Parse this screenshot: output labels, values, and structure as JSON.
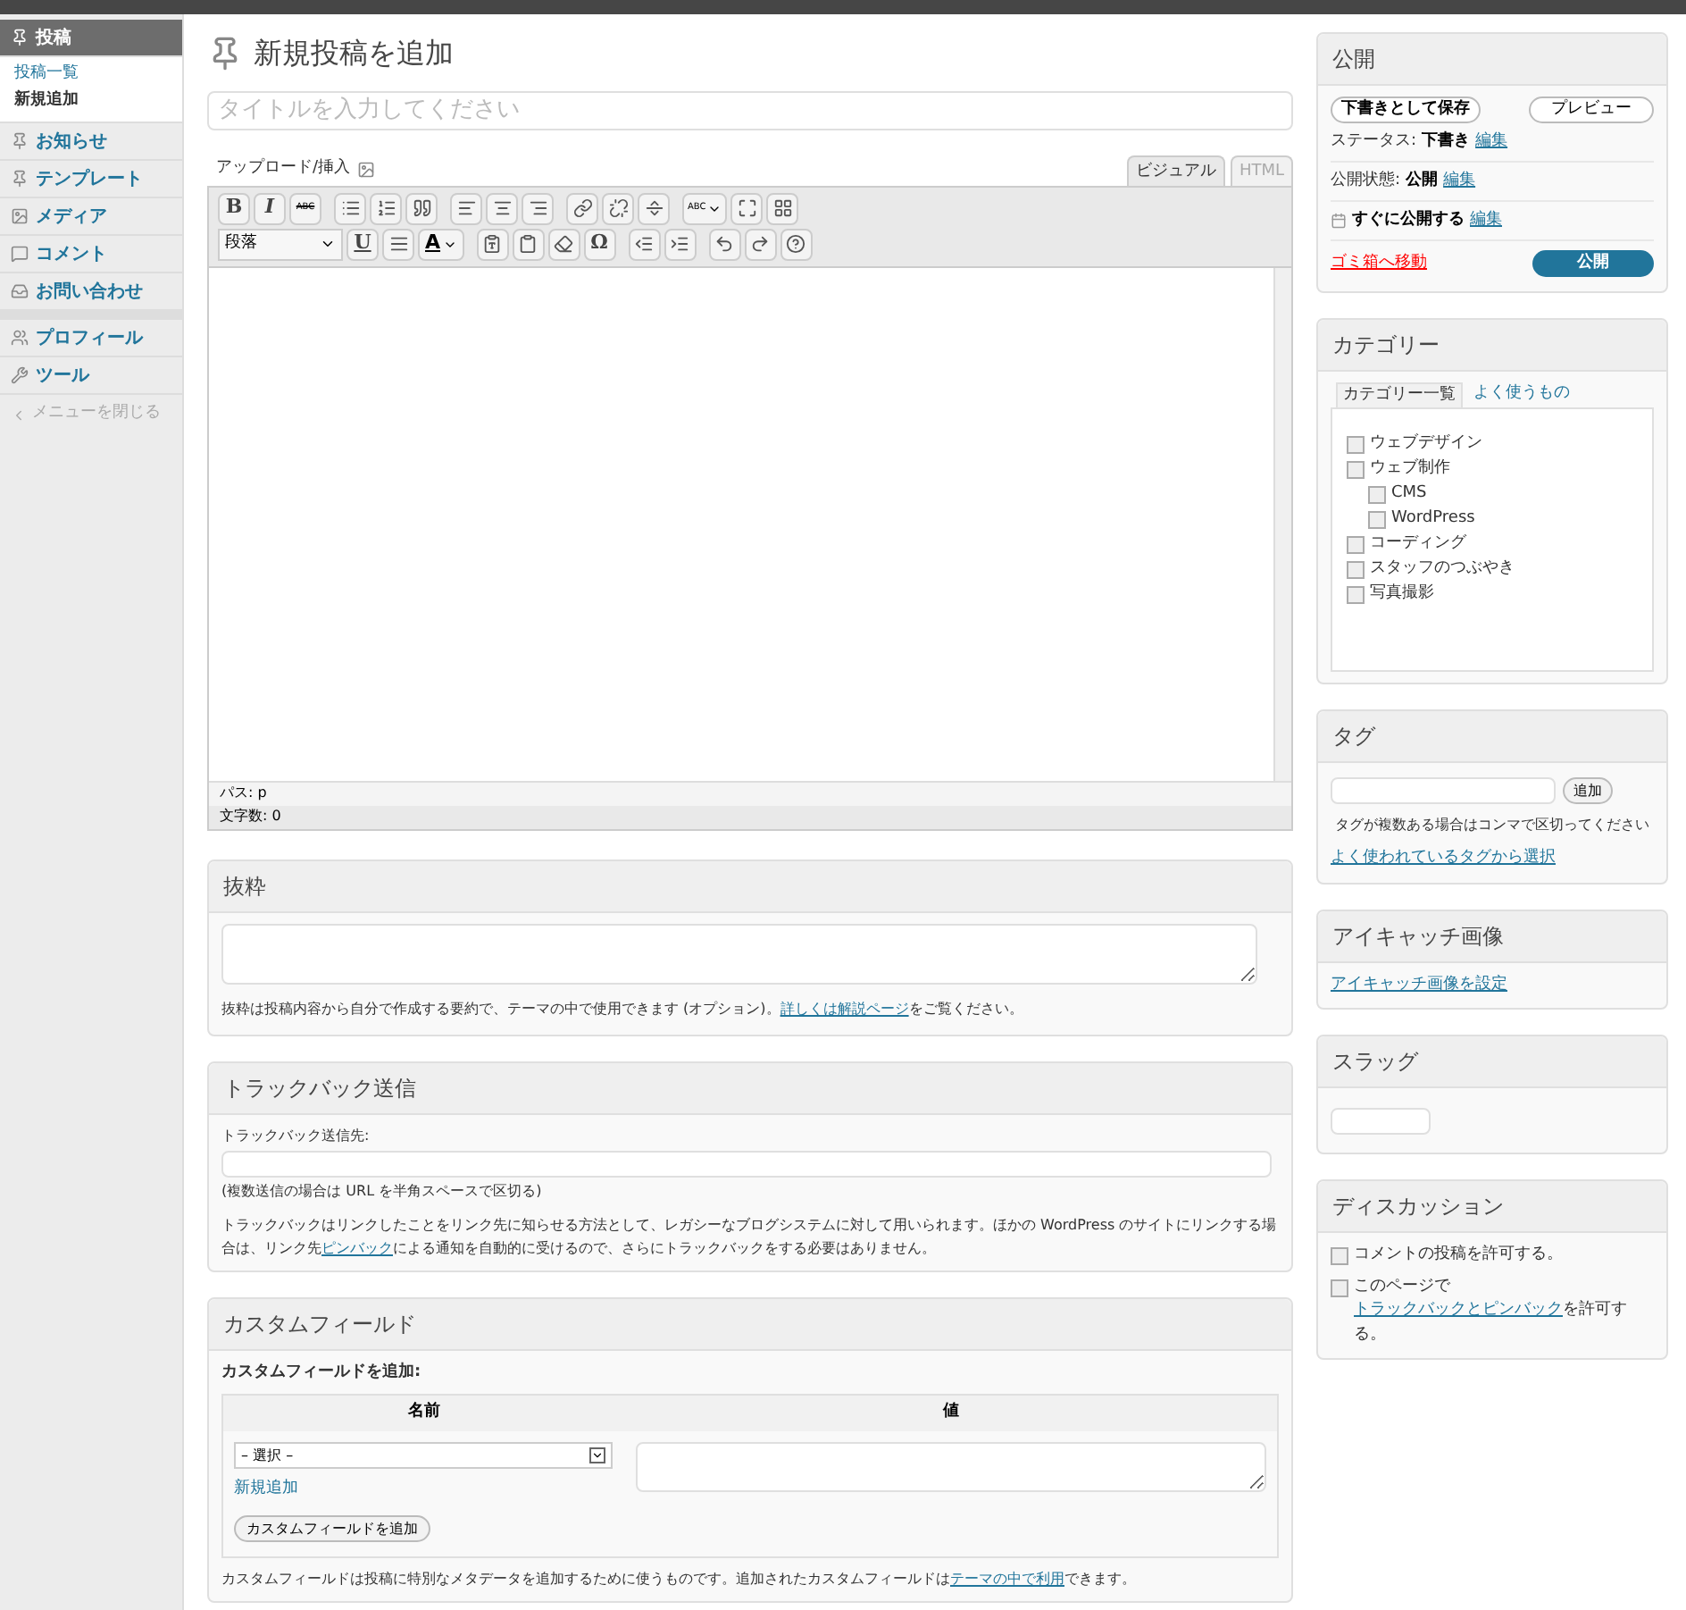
{
  "sidebar": {
    "groups": [
      {
        "items": [
          {
            "label": "投稿",
            "selected": true,
            "children": [
              {
                "label": "投稿一覧",
                "selected": false
              },
              {
                "label": "新規追加",
                "selected": true
              }
            ]
          },
          {
            "label": "お知らせ",
            "selected": false
          },
          {
            "label": "テンプレート",
            "selected": false
          },
          {
            "label": "メディア",
            "selected": false
          },
          {
            "label": "コメント",
            "selected": false
          },
          {
            "label": "お問い合わせ",
            "selected": false
          }
        ]
      },
      {
        "items": [
          {
            "label": "プロフィール",
            "selected": false
          },
          {
            "label": "ツール",
            "selected": false
          }
        ]
      }
    ],
    "collapse": "メニューを閉じる"
  },
  "page_title": "新規投稿を追加",
  "title_field": {
    "placeholder": "タイトルを入力してください"
  },
  "editor": {
    "upload": "アップロード/挿入",
    "tabs": [
      {
        "label": "ビジュアル",
        "selected": true
      },
      {
        "label": "HTML",
        "selected": false
      }
    ],
    "toolbar": {
      "bold": "B",
      "italic": "I",
      "strike": "ABC",
      "spell": "ABC",
      "format": "段落",
      "underline": "U",
      "font_color_label": "A",
      "omega": "Ω"
    },
    "path": "パス: p",
    "word_count": "文字数: 0"
  },
  "excerpt": {
    "title": "抜粋",
    "note_before": "抜粋は投稿内容から自分で作成する要約で、テーマの中で使用できます (オプション)。",
    "note_link": "詳しくは解説ページ",
    "note_after": "をご覧ください。"
  },
  "trackback": {
    "title": "トラックバック送信",
    "label": "トラックバック送信先:",
    "hint": "(複数送信の場合は URL を半角スペースで区切る)",
    "note_before": "トラックバックはリンクしたことをリンク先に知らせる方法として、レガシーなブログシステムに対して用いられます。ほかの WordPress のサイトにリンクする場合は、リンク先",
    "note_link": "ピンバック",
    "note_after": "による通知を自動的に受けるので、さらにトラックバックをする必要はありません。"
  },
  "custom_fields": {
    "title": "カスタムフィールド",
    "subtitle": "カスタムフィールドを追加:",
    "columns": [
      "名前",
      "値"
    ],
    "select": "– 選択 –",
    "new_link": "新規追加",
    "add_button": "カスタムフィールドを追加",
    "note_before": "カスタムフィールドは投稿に特別なメタデータを追加するために使うものです。追加されたカスタムフィールドは",
    "note_link": "テーマの中で利用",
    "note_after": "できます。"
  },
  "publish": {
    "title": "公開",
    "save_draft": "下書きとして保存",
    "preview": "プレビュー",
    "rows": [
      {
        "label": "ステータス:",
        "value": "下書き",
        "link": "編集"
      },
      {
        "label": "公開状態:",
        "value": "公開",
        "link": "編集"
      },
      {
        "label": "",
        "value": "すぐに公開する",
        "link": "編集"
      }
    ],
    "trash": "ゴミ箱へ移動",
    "publish_button": "公開"
  },
  "categories": {
    "title": "カテゴリー",
    "tabs": [
      {
        "label": "カテゴリー一覧",
        "selected": true
      },
      {
        "label": "よく使うもの",
        "selected": false
      }
    ],
    "items": [
      {
        "label": "ウェブデザイン",
        "checked": false
      },
      {
        "label": "ウェブ制作",
        "checked": false,
        "children": [
          {
            "label": "CMS",
            "checked": false
          },
          {
            "label": "WordPress",
            "checked": false
          }
        ]
      },
      {
        "label": "コーディング",
        "checked": false
      },
      {
        "label": "スタッフのつぶやき",
        "checked": false
      },
      {
        "label": "写真撮影",
        "checked": false
      }
    ]
  },
  "tags": {
    "title": "タグ",
    "add_button": "追加",
    "hint": "タグが複数ある場合はコンマで区切ってください",
    "link": "よく使われているタグから選択"
  },
  "eyecatch": {
    "title": "アイキャッチ画像",
    "link": "アイキャッチ画像を設定"
  },
  "slug": {
    "title": "スラッグ"
  },
  "discussion": {
    "title": "ディスカッション",
    "items": [
      {
        "before": "コメントの投稿を許可する。",
        "checked": false
      },
      {
        "before": "このページで ",
        "link": "トラックバックとピンバック",
        "after": "を許可する。",
        "checked": false
      }
    ]
  }
}
